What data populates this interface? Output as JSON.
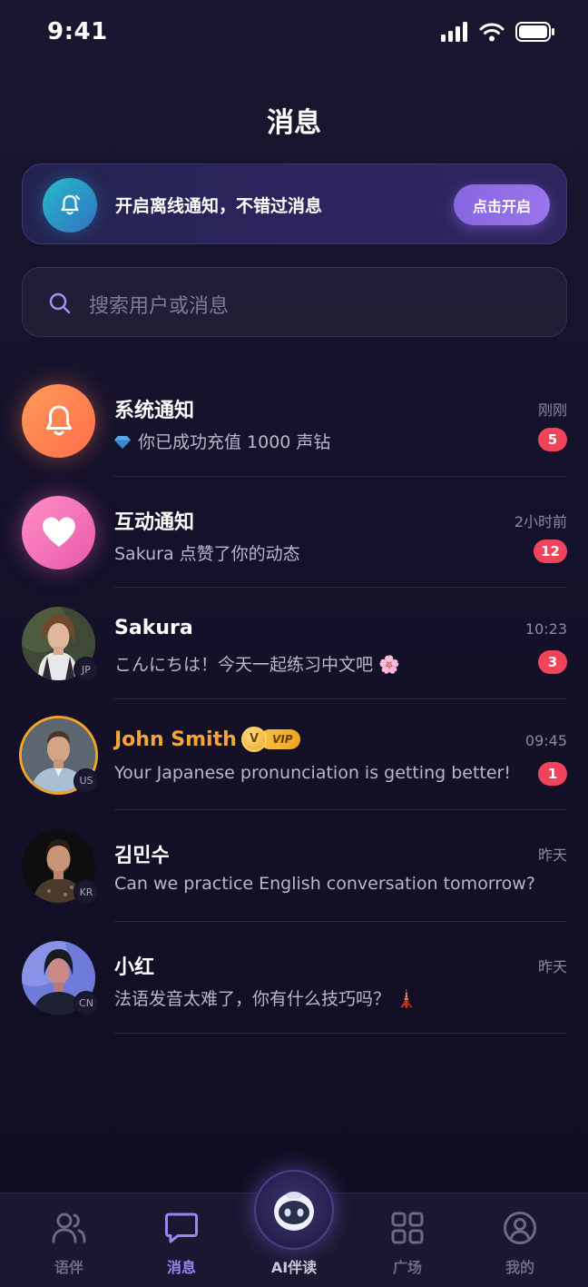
{
  "status_bar": {
    "time": "9:41"
  },
  "header": {
    "title": "消息"
  },
  "notify_banner": {
    "text": "开启离线通知，不错过消息",
    "button_label": "点击开启"
  },
  "search": {
    "placeholder": "搜索用户或消息"
  },
  "messages": [
    {
      "name": "系统通知",
      "preview": "你已成功充值 1000 声钻",
      "time": "刚刚",
      "unread": "5",
      "avatar": "bell-icon"
    },
    {
      "name": "互动通知",
      "preview": "Sakura 点赞了你的动态",
      "time": "2小时前",
      "unread": "12",
      "avatar": "heart-icon"
    },
    {
      "name": "Sakura",
      "preview": "こんにちは！今天一起练习中文吧 🌸",
      "time": "10:23",
      "unread": "3",
      "country": "JP"
    },
    {
      "name": "John Smith",
      "preview": "Your Japanese pronunciation is getting better!",
      "time": "09:45",
      "unread": "1",
      "country": "US",
      "vip_label": "VIP",
      "vip_crest": "V"
    },
    {
      "name": "김민수",
      "preview": "Can we practice English conversation tomorrow?",
      "time": "昨天",
      "country": "KR"
    },
    {
      "name": "小红",
      "preview": "法语发音太难了，你有什么技巧吗？ 🗼",
      "time": "昨天",
      "country": "CN"
    }
  ],
  "bottom_nav": {
    "items": [
      {
        "label": "语伴",
        "icon": "users-icon"
      },
      {
        "label": "消息",
        "icon": "chat-icon",
        "active": true
      },
      {
        "label": "AI伴读",
        "icon": "robot-icon"
      },
      {
        "label": "广场",
        "icon": "grid-icon"
      },
      {
        "label": "我的",
        "icon": "profile-icon"
      }
    ]
  },
  "colors": {
    "background": "#14112a",
    "accent": "#9b85f0",
    "badge": "#f0445a",
    "vip": "#f5a63a"
  }
}
